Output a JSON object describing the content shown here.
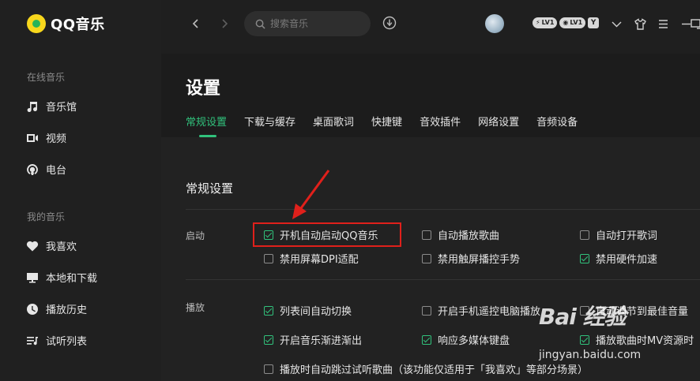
{
  "app": {
    "name": "QQ音乐"
  },
  "sidebar": {
    "online_section": "在线音乐",
    "online_items": [
      {
        "label": "音乐馆",
        "icon": "music-note-icon"
      },
      {
        "label": "视频",
        "icon": "video-icon"
      },
      {
        "label": "电台",
        "icon": "radio-icon"
      }
    ],
    "my_section": "我的音乐",
    "my_items": [
      {
        "label": "我喜欢",
        "icon": "heart-icon"
      },
      {
        "label": "本地和下载",
        "icon": "monitor-icon"
      },
      {
        "label": "播放历史",
        "icon": "history-icon"
      },
      {
        "label": "试听列表",
        "icon": "playlist-icon"
      }
    ]
  },
  "topbar": {
    "search_placeholder": "搜索音乐",
    "badges": [
      "LV1",
      "LV1"
    ],
    "badge_y": "Y"
  },
  "settings": {
    "title": "设置",
    "tabs": [
      {
        "label": "常规设置",
        "active": true
      },
      {
        "label": "下载与缓存",
        "active": false
      },
      {
        "label": "桌面歌词",
        "active": false
      },
      {
        "label": "快捷键",
        "active": false
      },
      {
        "label": "音效插件",
        "active": false
      },
      {
        "label": "网络设置",
        "active": false
      },
      {
        "label": "音频设备",
        "active": false
      }
    ],
    "section_title": "常规设置",
    "startup": {
      "label": "启动",
      "options": [
        {
          "label": "开机自动启动QQ音乐",
          "checked": true
        },
        {
          "label": "自动播放歌曲",
          "checked": false
        },
        {
          "label": "自动打开歌词",
          "checked": false
        },
        {
          "label": "禁用屏幕DPI适配",
          "checked": false
        },
        {
          "label": "禁用触屏播控手势",
          "checked": false
        },
        {
          "label": "禁用硬件加速",
          "checked": true
        }
      ]
    },
    "playback": {
      "label": "播放",
      "options": [
        {
          "label": "列表间自动切换",
          "checked": true
        },
        {
          "label": "开启手机遥控电脑播放",
          "checked": false
        },
        {
          "label": "自动调节到最佳音量",
          "checked": false
        },
        {
          "label": "开启音乐渐进渐出",
          "checked": true
        },
        {
          "label": "响应多媒体键盘",
          "checked": true
        },
        {
          "label": "播放歌曲时MV资源时",
          "checked": true
        },
        {
          "label": "播放时自动跳过试听歌曲（该功能仅适用于「我喜欢」等部分场景）",
          "checked": false
        }
      ]
    }
  },
  "watermark": {
    "main": "Bai 经验",
    "sub": "jingyan.baidu.com"
  },
  "colors": {
    "accent": "#31c27c",
    "highlight": "#e0201b"
  }
}
